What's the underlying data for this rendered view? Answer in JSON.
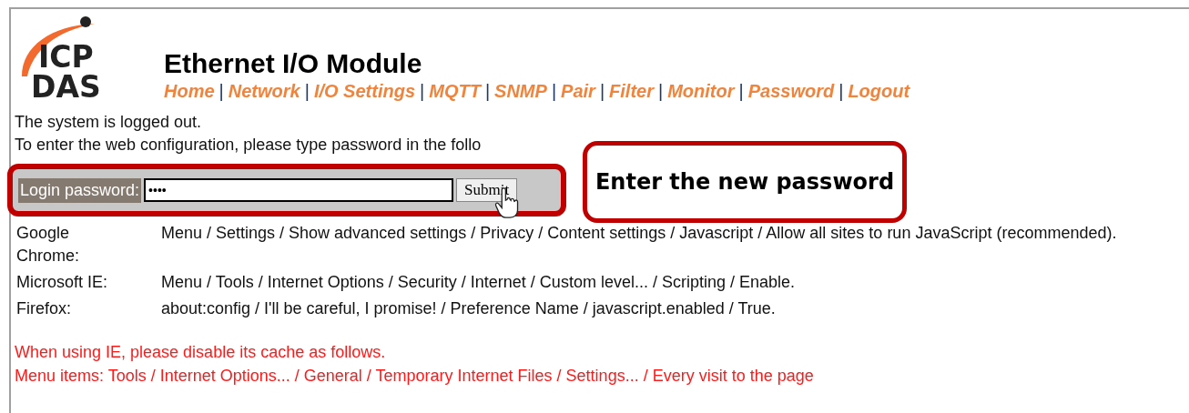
{
  "logo": {
    "lines": [
      "ICP",
      "DAS"
    ]
  },
  "title": "Ethernet I/O Module",
  "nav": {
    "separator": "|",
    "items": [
      "Home",
      "Network",
      "I/O Settings",
      "MQTT",
      "SNMP",
      "Pair",
      "Filter",
      "Monitor",
      "Password",
      "Logout"
    ]
  },
  "messages": [
    "The system is logged out.",
    "To enter the web configuration, please type password in the follo"
  ],
  "login": {
    "label": "Login password:",
    "value": "••••",
    "button": "Submit"
  },
  "browsers": [
    {
      "name": "Google Chrome:",
      "steps": "Menu / Settings / Show advanced settings / Privacy / Content settings / Javascript / Allow all sites to run JavaScript (recommended)."
    },
    {
      "name": "Microsoft IE:",
      "steps": "Menu / Tools / Internet Options / Security / Internet / Custom level... / Scripting / Enable."
    },
    {
      "name": "Firefox:",
      "steps": "about:config / I'll be careful, I promise! / Preference Name / javascript.enabled / True."
    }
  ],
  "cache_notes": [
    "When using IE, please disable its cache as follows.",
    "Menu items: Tools / Internet Options... / General / Temporary Internet Files / Settings... / Every visit to the page"
  ],
  "callout": {
    "text": "Enter the new password"
  }
}
